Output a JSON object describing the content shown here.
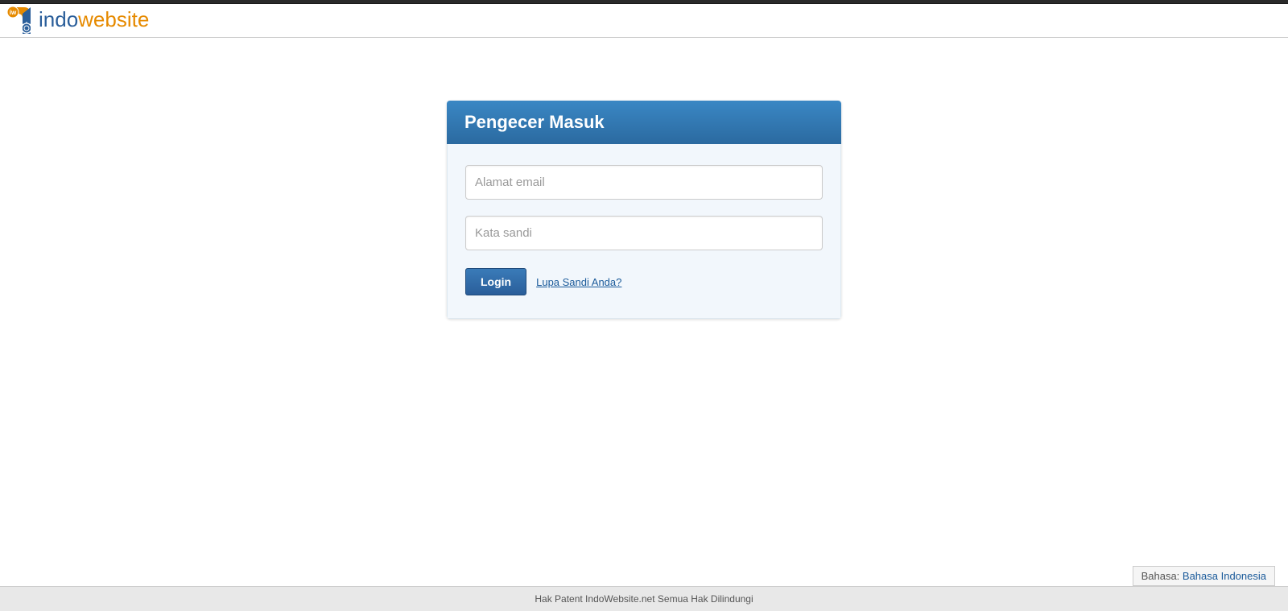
{
  "logo": {
    "part1": "indo",
    "part2": "web",
    "part3": "site"
  },
  "panel": {
    "title": "Pengecer Masuk"
  },
  "form": {
    "email_placeholder": "Alamat email",
    "password_placeholder": "Kata sandi",
    "login_button": "Login",
    "forgot_link": "Lupa Sandi Anda?"
  },
  "footer": {
    "language_label": "Bahasa: ",
    "language_value": "Bahasa Indonesia",
    "copyright": "Hak Patent IndoWebsite.net Semua Hak Dilindungi"
  }
}
